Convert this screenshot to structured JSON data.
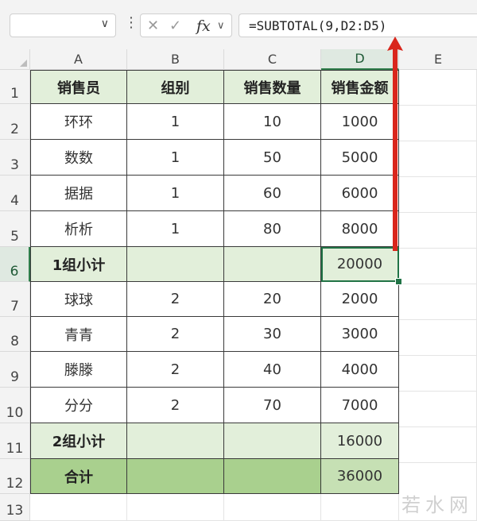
{
  "formula_bar": {
    "name_box_value": "",
    "icons": [
      "chevron-down-icon",
      "more-vertical-icon",
      "cancel-icon",
      "enter-check-icon",
      "fx-icon",
      "chevron-down-icon"
    ],
    "formula": "=SUBTOTAL(9,D2:D5)"
  },
  "columns": [
    "A",
    "B",
    "C",
    "D",
    "E"
  ],
  "rows": [
    "1",
    "2",
    "3",
    "4",
    "5",
    "6",
    "7",
    "8",
    "9",
    "10",
    "11",
    "12",
    "13"
  ],
  "table": {
    "header": [
      "销售员",
      "组别",
      "销售数量",
      "销售金额"
    ],
    "r2": [
      "环环",
      "1",
      "10",
      "1000"
    ],
    "r3": [
      "数数",
      "1",
      "50",
      "5000"
    ],
    "r4": [
      "据据",
      "1",
      "60",
      "6000"
    ],
    "r5": [
      "析析",
      "1",
      "80",
      "8000"
    ],
    "r6": [
      "1组小计",
      "",
      "",
      "20000"
    ],
    "r7": [
      "球球",
      "2",
      "20",
      "2000"
    ],
    "r8": [
      "青青",
      "2",
      "30",
      "3000"
    ],
    "r9": [
      "滕滕",
      "2",
      "40",
      "4000"
    ],
    "r10": [
      "分分",
      "2",
      "70",
      "7000"
    ],
    "r11": [
      "2组小计",
      "",
      "",
      "16000"
    ],
    "r12": [
      "合计",
      "",
      "",
      "36000"
    ]
  },
  "selection": {
    "active_cell": "D6",
    "active_column": "D",
    "active_row": "6"
  },
  "colors": {
    "header_fill": "#e2efda",
    "total_fill": "#a9d08e",
    "selection": "#217346",
    "arrow": "#d9261c"
  },
  "watermark": "若水网"
}
